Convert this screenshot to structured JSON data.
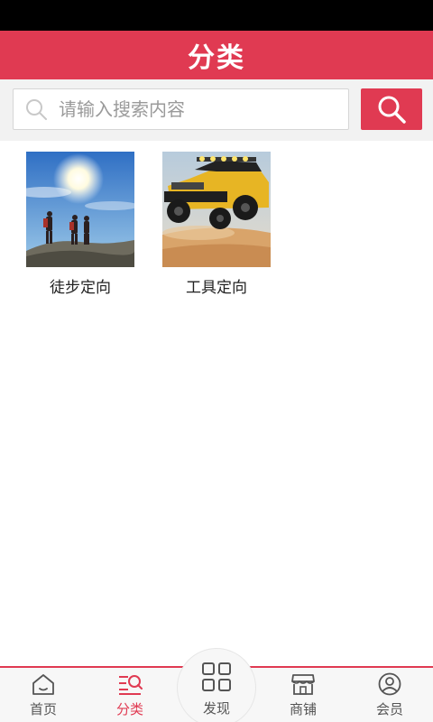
{
  "header": {
    "title": "分类"
  },
  "search": {
    "placeholder": "请输入搜索内容"
  },
  "categories": [
    {
      "label": "徒步定向",
      "image": "hikers-on-mountain"
    },
    {
      "label": "工具定向",
      "image": "yellow-offroad-truck"
    }
  ],
  "tabbar": {
    "items": [
      {
        "label": "首页",
        "icon": "home-icon"
      },
      {
        "label": "分类",
        "icon": "category-list-icon",
        "active": true
      },
      {
        "label": "发现",
        "icon": "grid-icon"
      },
      {
        "label": "商铺",
        "icon": "shop-icon"
      },
      {
        "label": "会员",
        "icon": "user-icon"
      }
    ]
  },
  "colors": {
    "accent": "#e03a52",
    "status_bar": "#000000",
    "search_bg": "#f2f2f2"
  }
}
